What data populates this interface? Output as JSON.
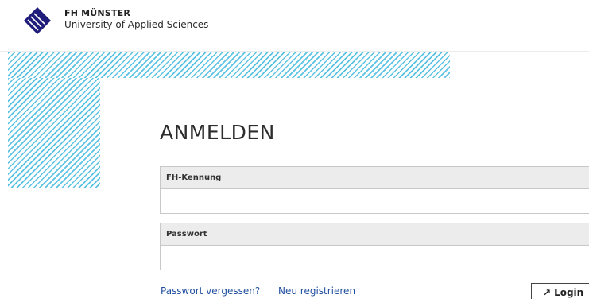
{
  "header": {
    "org_name": "FH MÜNSTER",
    "org_sub": "University of Applied Sciences",
    "logo_icon": "fh-muenster-logo-icon",
    "logo_color": "#1f1c7b"
  },
  "decoration": {
    "hatch_color": "#5bc2e4"
  },
  "login": {
    "title": "ANMELDEN",
    "username": {
      "label": "FH-Kennung",
      "value": ""
    },
    "password": {
      "label": "Passwort",
      "value": ""
    },
    "forgot_link": "Passwort vergessen?",
    "register_link": "Neu registrieren",
    "login_button": "Login",
    "login_icon": "arrow-up-right-icon",
    "login_arrow": "↗"
  },
  "colors": {
    "link": "#1f4d9e",
    "field_label_bg": "#ececec",
    "border": "#c8c8c8"
  }
}
